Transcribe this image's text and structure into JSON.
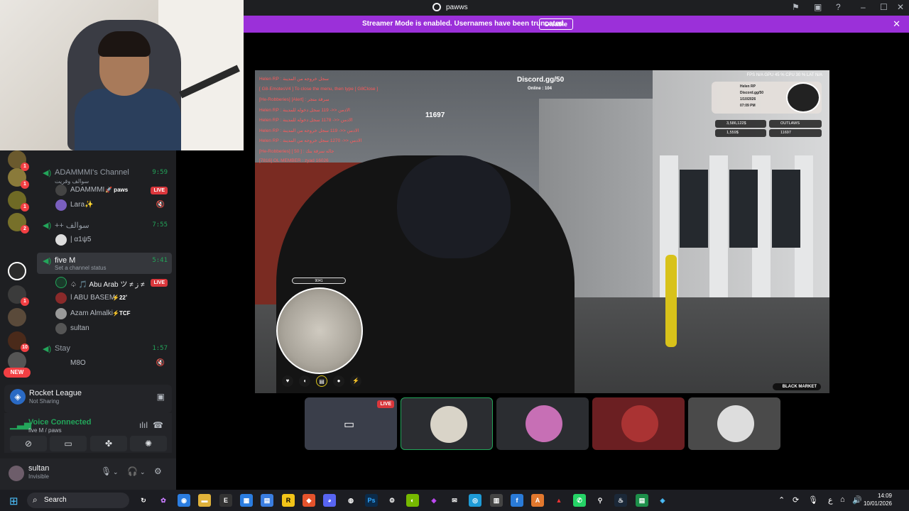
{
  "window": {
    "app_name": "pawws"
  },
  "banner": {
    "text": "Streamer Mode is enabled. Usernames have been truncated.",
    "button": "Disable"
  },
  "servers": {
    "badges": [
      "1",
      "1",
      "1",
      "2",
      "1",
      "1",
      "10"
    ],
    "new_label": "NEW"
  },
  "channels": [
    {
      "name": "ADAMMMI's Channel",
      "timer": "9:59",
      "status": "سوالف وقريت",
      "members": [
        {
          "name": "ADAMMMI",
          "tag": "🚀 paws",
          "live": "LIVE"
        },
        {
          "name": "Lara✨",
          "icon": "🔇"
        }
      ]
    },
    {
      "name": "++ سوالف",
      "timer": "7:55",
      "members": [
        {
          "name": "| α1ψ5"
        }
      ]
    },
    {
      "name": "five M",
      "timer": "5:41",
      "status": "Set a channel status",
      "members": [
        {
          "name": "♤ 🎵 Abu Arab ツ ≠ ﺯ ≠",
          "live": "LIVE"
        },
        {
          "name": "ǀ ABU BASEM",
          "tag": "⚡22˚"
        },
        {
          "name": "Azam Almalki",
          "tag": "⚡TCF"
        },
        {
          "name": "sultan"
        }
      ]
    },
    {
      "name": "Stay",
      "timer": "1:57",
      "members": [
        {
          "name": "M8O",
          "icon": "🔇"
        }
      ]
    }
  ],
  "activity": {
    "game": "Rocket League",
    "status": "Not Sharing"
  },
  "voice": {
    "title": "Voice Connected",
    "sub": "five M / paws"
  },
  "user": {
    "name": "sultan",
    "status": "Invisible"
  },
  "game_hud": {
    "server": "Discord.gg/50",
    "online": "Online : 104",
    "counter": "11697",
    "feed": [
      "Helen RP : سجل خروجه من المدينة",
      "[ G8-EmotesV4 ] To close the menu, then type [ G8Close ]",
      "[He-Robberies] [Alert] : سرقة متجر",
      "Helen RP : الادمن <<- 119 سجل دخوله للمدينة",
      "Helen RP : الادمن <<- 1178 سجل دخوله للمدينة",
      "Helen RP : الادمن <<- 119 سجل خروجه من المدينة",
      "Helen RP : الادمن <<- 1270 سجل خروجه من المدينة",
      "[He-Robberies] [ 50 ] : جاله سرقة بنك",
      "[7816] OL MEMBER : zyad 16026"
    ],
    "fps": "FPS N/A   GPU 45 %   CPU 30 %   LAT N/A",
    "cash": "3,586,122$",
    "bank": "1,559$",
    "faction": "OUTLAWS",
    "id": "11697",
    "minimap_label": "9041",
    "black_market": "BLACK MARKET",
    "profile_lines": [
      "Helen RP",
      "Discord.gg/50",
      "1/10/2026",
      "07:09 PM"
    ]
  },
  "tiles": {
    "live_label": "LIVE"
  },
  "taskbar": {
    "search": "Search",
    "time": "14:09",
    "date": "10/01/2026",
    "lang": "ع"
  },
  "colors": {
    "accent": "#9b30d9",
    "green": "#23a55a",
    "red": "#da373c"
  }
}
